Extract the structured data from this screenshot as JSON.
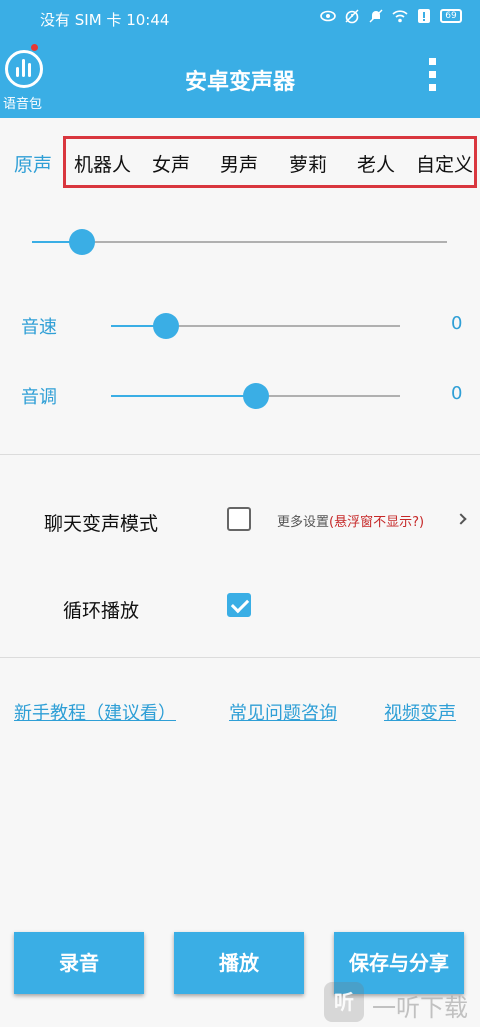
{
  "status_bar": {
    "carrier_time": "没有 SIM 卡 10:44",
    "battery": "69",
    "icons": [
      "eye-icon",
      "alarm-icon",
      "mute-icon",
      "wifi-icon",
      "alert-icon",
      "battery-icon"
    ]
  },
  "header": {
    "logo_label": "语音包",
    "title": "安卓变声器",
    "menu_icon": "more-vert-icon"
  },
  "voices": {
    "items": [
      "原声",
      "机器人",
      "女声",
      "男声",
      "萝莉",
      "老人",
      "自定义"
    ],
    "selected": "原声"
  },
  "effect_slider": {
    "level": 0.12
  },
  "speed": {
    "label": "音速",
    "value": "0",
    "level": 0.19
  },
  "pitch": {
    "label": "音调",
    "value": "0",
    "level": 0.5
  },
  "options": {
    "chat_mode": {
      "label": "聊天变声模式",
      "checked": false
    },
    "more_settings": {
      "text": "更多设置",
      "warning": "(悬浮窗不显示?)"
    },
    "loop_play": {
      "label": "循环播放",
      "checked": true
    }
  },
  "links": {
    "tutorial": "新手教程（建议看）",
    "faq": "常见问题咨询",
    "video": "视频变声"
  },
  "buttons": {
    "record": "录音",
    "play": "播放",
    "save_share": "保存与分享"
  },
  "watermark": {
    "badge": "听",
    "text": "一听下载"
  },
  "colors": {
    "accent": "#3aaee5",
    "highlight_border": "#d9363e",
    "warning": "#c62828"
  }
}
